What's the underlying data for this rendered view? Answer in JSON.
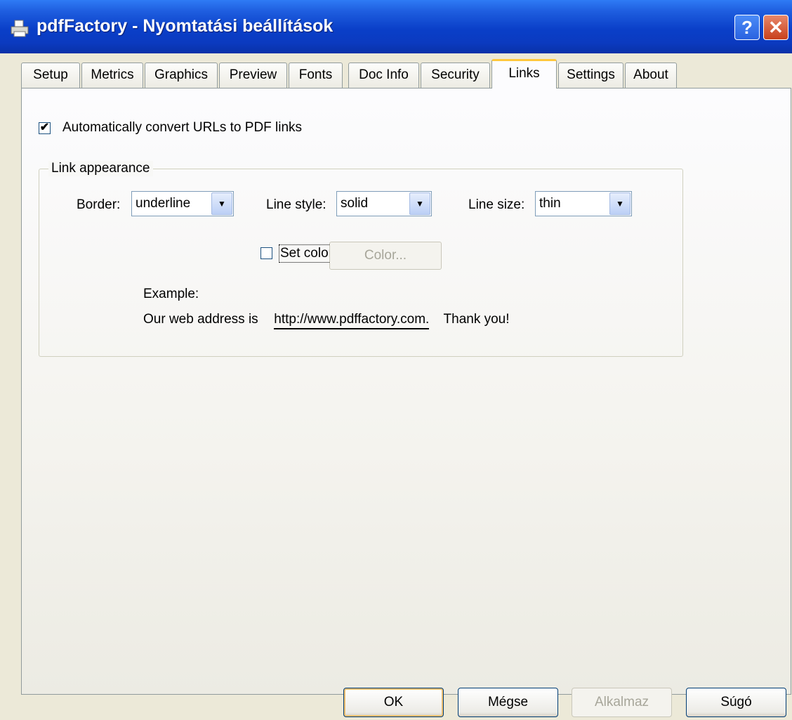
{
  "window": {
    "title": "pdfFactory - Nyomtatási beállítások",
    "help_label": "?",
    "close_label": "✕"
  },
  "tabs": [
    {
      "label": "Setup"
    },
    {
      "label": "Metrics"
    },
    {
      "label": "Graphics"
    },
    {
      "label": "Preview"
    },
    {
      "label": "Fonts"
    },
    {
      "label": "Doc Info"
    },
    {
      "label": "Security"
    },
    {
      "label": "Links",
      "active": true
    },
    {
      "label": "Settings"
    },
    {
      "label": "About"
    }
  ],
  "links": {
    "auto_convert": {
      "label": "Automatically convert URLs to PDF links",
      "checked": true,
      "mark": "✔"
    },
    "group_title": "Link appearance",
    "border": {
      "label": "Border:",
      "value": "underline"
    },
    "line_style": {
      "label": "Line style:",
      "value": "solid"
    },
    "line_size": {
      "label": "Line size:",
      "value": "thin"
    },
    "set_color": {
      "label": "Set color:",
      "checked": false
    },
    "color_button": "Color...",
    "example_label": "Example:",
    "example_prefix": "Our web address is",
    "example_url": "http://www.pdffactory.com.",
    "example_suffix": "Thank you!"
  },
  "buttons": {
    "ok": "OK",
    "cancel": "Mégse",
    "apply": "Alkalmaz",
    "help": "Súgó"
  },
  "colors": {
    "titlebar": "#0a3fc8",
    "dialog_bg": "#ece9d8",
    "active_tab_accent": "#ffc83c"
  }
}
